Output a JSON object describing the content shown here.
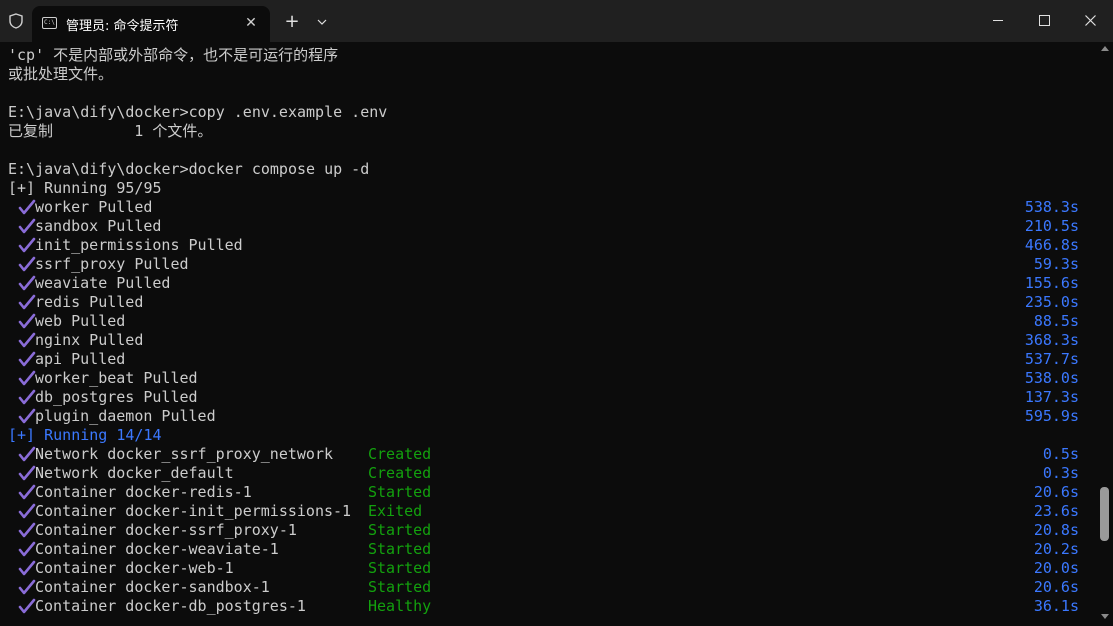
{
  "window": {
    "tab_title": "管理员: 命令提示符",
    "tab_icon_text": "C:\\",
    "new_tab_symbol": "+",
    "dropdown_symbol": "⌄",
    "close_symbol": "✕"
  },
  "terminal": {
    "msg1": "'cp' 不是内部或外部命令，也不是可运行的程序",
    "msg2": "或批处理文件。",
    "cmd1": "E:\\java\\dify\\docker>copy .env.example .env",
    "copy_result": "已复制         1 个文件。",
    "cmd2": "E:\\java\\dify\\docker>docker compose up -d",
    "running1": "[+] Running 95/95",
    "pulls": [
      {
        "name": "worker Pulled",
        "time": "538.3s"
      },
      {
        "name": "sandbox Pulled",
        "time": "210.5s"
      },
      {
        "name": "init_permissions Pulled",
        "time": "466.8s"
      },
      {
        "name": "ssrf_proxy Pulled",
        "time": "59.3s"
      },
      {
        "name": "weaviate Pulled",
        "time": "155.6s"
      },
      {
        "name": "redis Pulled",
        "time": "235.0s"
      },
      {
        "name": "web Pulled",
        "time": "88.5s"
      },
      {
        "name": "nginx Pulled",
        "time": "368.3s"
      },
      {
        "name": "api Pulled",
        "time": "537.7s"
      },
      {
        "name": "worker_beat Pulled",
        "time": "538.0s"
      },
      {
        "name": "db_postgres Pulled",
        "time": "137.3s"
      },
      {
        "name": "plugin_daemon Pulled",
        "time": "595.9s"
      }
    ],
    "running2": "[+] Running 14/14",
    "resources": [
      {
        "name": "Network docker_ssrf_proxy_network",
        "status": "Created",
        "time": "0.5s"
      },
      {
        "name": "Network docker_default",
        "status": "Created",
        "time": "0.3s"
      },
      {
        "name": "Container docker-redis-1",
        "status": "Started",
        "time": "20.6s"
      },
      {
        "name": "Container docker-init_permissions-1",
        "status": "Exited",
        "time": "23.6s"
      },
      {
        "name": "Container docker-ssrf_proxy-1",
        "status": "Started",
        "time": "20.8s"
      },
      {
        "name": "Container docker-weaviate-1",
        "status": "Started",
        "time": "20.2s"
      },
      {
        "name": "Container docker-web-1",
        "status": "Started",
        "time": "20.0s"
      },
      {
        "name": "Container docker-sandbox-1",
        "status": "Started",
        "time": "20.6s"
      },
      {
        "name": "Container docker-db_postgres-1",
        "status": "Healthy",
        "time": "36.1s"
      }
    ]
  },
  "colors": {
    "background": "#0c0c0c",
    "text": "#cccccc",
    "blue": "#3b78ff",
    "green": "#13a10e",
    "check": "#8a6cd8"
  }
}
